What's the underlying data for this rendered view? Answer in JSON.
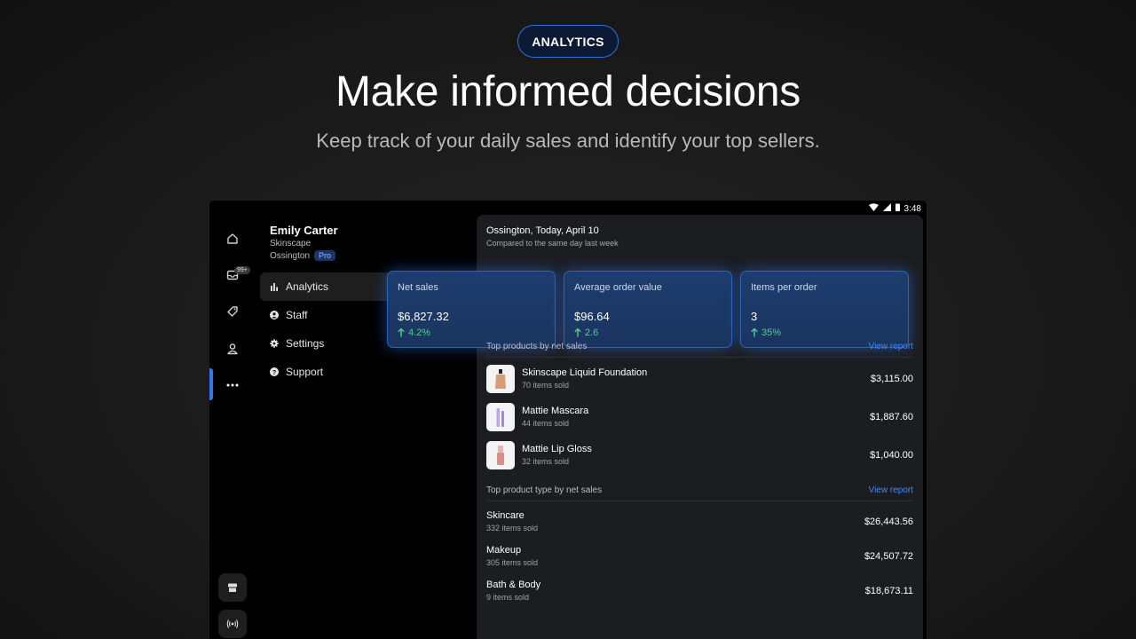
{
  "hero": {
    "badge": "ANALYTICS",
    "title": "Make informed decisions",
    "subtitle": "Keep track of your daily sales and identify your top sellers."
  },
  "status_bar": {
    "time": "3:48",
    "icons": [
      "wifi-icon",
      "signal-icon",
      "battery-icon"
    ]
  },
  "rail": {
    "items": [
      "home-icon",
      "inbox-icon",
      "tag-icon",
      "person-icon",
      "more-icon"
    ],
    "inbox_badge": "99+",
    "bottom": [
      "store-icon",
      "broadcast-icon"
    ],
    "active_color": "#2f7af0"
  },
  "user": {
    "name": "Emily Carter",
    "company": "Skinscape",
    "location": "Ossington",
    "plan": "Pro"
  },
  "nav": {
    "items": [
      {
        "label": "Analytics",
        "icon": "chart-icon",
        "active": true
      },
      {
        "label": "Staff",
        "icon": "user-circle-icon",
        "active": false
      },
      {
        "label": "Settings",
        "icon": "gear-icon",
        "active": false
      },
      {
        "label": "Support",
        "icon": "help-icon",
        "active": false
      }
    ]
  },
  "panel": {
    "title": "Ossington, Today, April 10",
    "subtitle": "Compared to the same day last week",
    "metrics": [
      {
        "label": "Net sales",
        "value": "$6,827.32",
        "delta": "4.2%"
      },
      {
        "label": "Average order value",
        "value": "$96.64",
        "delta": "2.6"
      },
      {
        "label": "Items per order",
        "value": "3",
        "delta": "35%"
      }
    ],
    "top_products": {
      "title": "Top products by net sales",
      "link": "View report",
      "rows": [
        {
          "name": "Skinscape Liquid Foundation",
          "sold": "70 items sold",
          "amount": "$3,115.00"
        },
        {
          "name": "Mattie Mascara",
          "sold": "44 items sold",
          "amount": "$1,887.60"
        },
        {
          "name": "Mattie Lip Gloss",
          "sold": "32 items sold",
          "amount": "$1,040.00"
        }
      ]
    },
    "top_types": {
      "title": "Top product type by net sales",
      "link": "View report",
      "rows": [
        {
          "name": "Skincare",
          "sold": "332 items sold",
          "amount": "$26,443.56"
        },
        {
          "name": "Makeup",
          "sold": "305 items sold",
          "amount": "$24,507.72"
        },
        {
          "name": "Bath & Body",
          "sold": "9 items sold",
          "amount": "$18,673.11"
        }
      ]
    },
    "accent_color": "#3d8bff",
    "positive_color": "#4fd08f"
  }
}
